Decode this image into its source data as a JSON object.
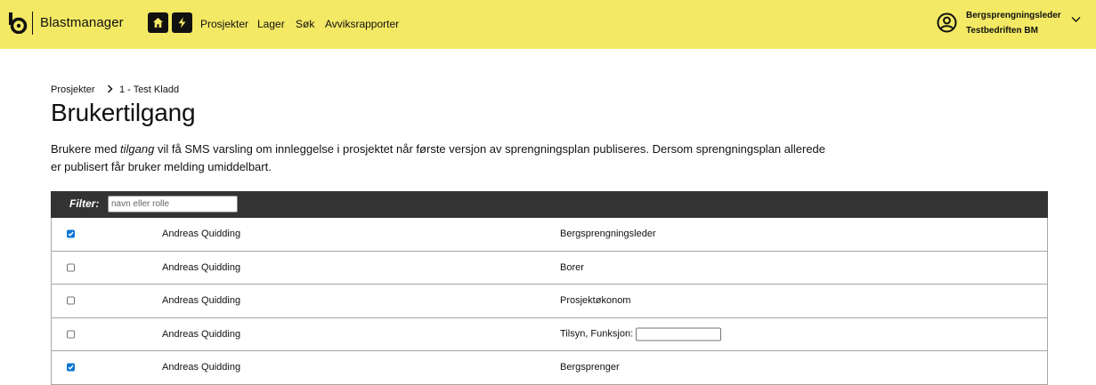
{
  "header": {
    "brand": "Blastmanager",
    "nav": [
      {
        "label": "Prosjekter"
      },
      {
        "label": "Lager"
      },
      {
        "label": "Søk"
      },
      {
        "label": "Avviksrapporter"
      }
    ],
    "user": {
      "role": "Bergsprengningsleder",
      "company": "Testbedriften BM"
    }
  },
  "breadcrumb": {
    "parent": "Prosjekter",
    "current": "1 - Test Kladd"
  },
  "page": {
    "title": "Brukertilgang",
    "desc_before": "Brukere med ",
    "desc_em": "tilgang",
    "desc_after": " vil få SMS varsling om innleggelse i prosjektet når første versjon av sprengningsplan publiseres. Dersom sprengningsplan allerede er publisert får bruker melding umiddelbart."
  },
  "filter": {
    "label": "Filter:",
    "placeholder": "navn eller rolle",
    "value": ""
  },
  "table": {
    "rows": [
      {
        "checked": true,
        "name": "Andreas Quidding",
        "role": "Bergsprengningsleder",
        "has_input": false
      },
      {
        "checked": false,
        "name": "Andreas Quidding",
        "role": "Borer",
        "has_input": false
      },
      {
        "checked": false,
        "name": "Andreas Quidding",
        "role": "Prosjektøkonom",
        "has_input": false
      },
      {
        "checked": false,
        "name": "Andreas Quidding",
        "role": "Tilsyn, Funksjon:",
        "has_input": true,
        "input_value": ""
      },
      {
        "checked": true,
        "name": "Andreas Quidding",
        "role": "Bergsprenger",
        "has_input": false
      }
    ]
  },
  "colors": {
    "header_bg": "#f3e964",
    "filter_bg": "#333333",
    "checkbox_checked": "#0b75d4"
  },
  "icons": [
    "blastmanager-logo-icon",
    "home-icon",
    "lightning-icon",
    "user-circle-icon",
    "chevron-down-icon",
    "chevron-right-icon",
    "checkmark-icon"
  ]
}
